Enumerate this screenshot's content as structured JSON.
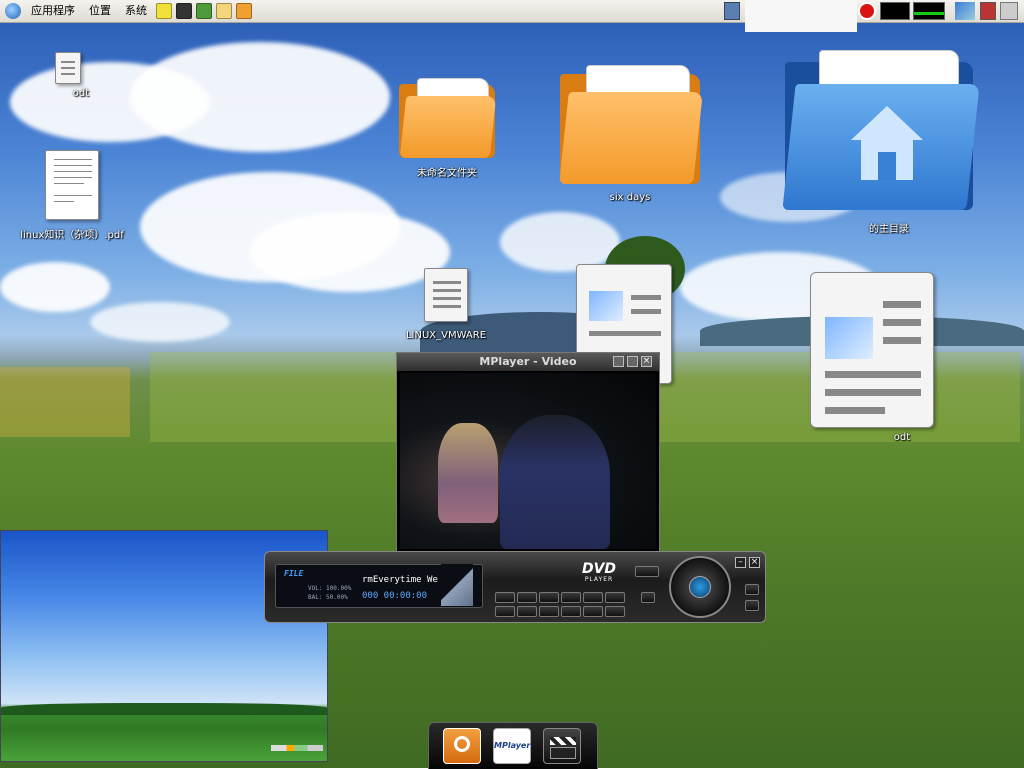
{
  "top_panel": {
    "menus": [
      "应用程序",
      "位置",
      "系统"
    ],
    "launchers": [
      "notes-icon",
      "terminal-icon",
      "books-icon",
      "editor-icon",
      "folder-icon"
    ]
  },
  "desktop_icons": {
    "odt_small": "odt",
    "pdf": "linux知识（杂项）.pdf",
    "untitled_folder": "未命名文件夹",
    "six_days": "six days",
    "home": "的主目录",
    "linux_vmware": "LINUX_VMWARE",
    "odt_large": "odt"
  },
  "mplayer": {
    "title": "MPlayer - Video"
  },
  "dvd_player": {
    "file_label": "FILE",
    "vol_label": "VOL: 100.00%",
    "bal_label": "BAL: 50.00%",
    "scroll_text": "rmEverytime We Tou",
    "time_display": "000 00:00:00",
    "brand": "DVD",
    "brand_sub": "PLAYER"
  },
  "dock": {
    "items": [
      "search-app-icon",
      "MPlayer",
      "video-clapper-icon"
    ],
    "mplayer_label": "MPlayer"
  },
  "colors": {
    "panel": "#dedbd2",
    "folder_orange": "#f39a2a",
    "home_blue": "#2f77d0",
    "dvd_body": "#2b2b2b"
  }
}
